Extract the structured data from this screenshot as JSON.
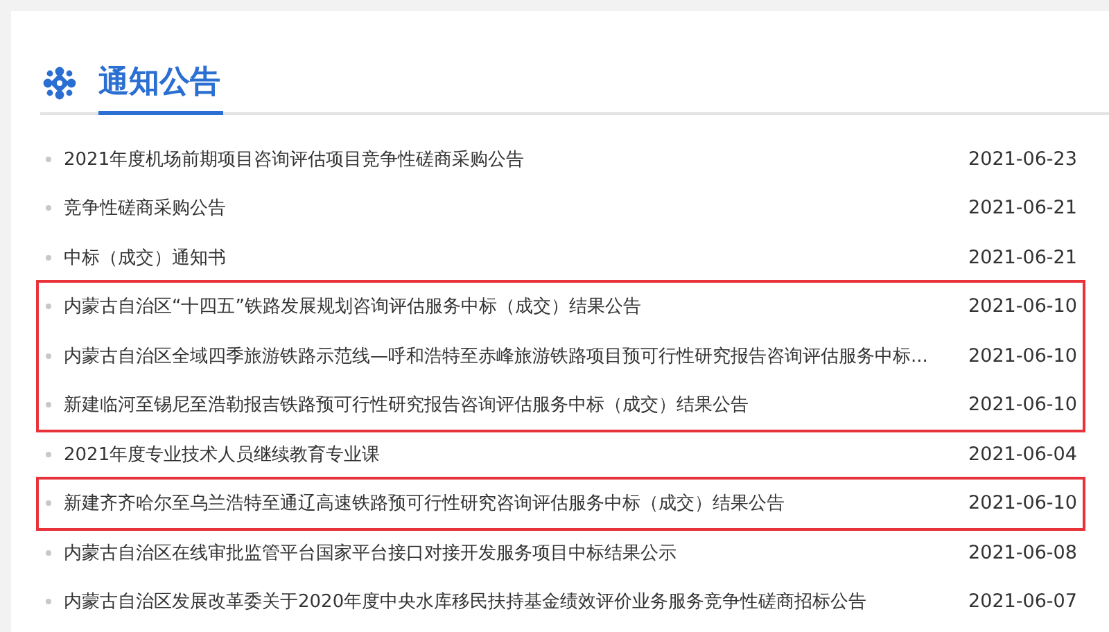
{
  "section": {
    "title": "通知公告"
  },
  "groups": [
    {
      "highlighted": false,
      "items": [
        {
          "title": "2021年度机场前期项目咨询评估项目竞争性磋商采购公告",
          "date": "2021-06-23"
        },
        {
          "title": "竞争性磋商采购公告",
          "date": "2021-06-21"
        },
        {
          "title": "中标（成交）通知书",
          "date": "2021-06-21"
        }
      ]
    },
    {
      "highlighted": true,
      "items": [
        {
          "title": "内蒙古自治区“十四五”铁路发展规划咨询评估服务中标（成交）结果公告",
          "date": "2021-06-10"
        },
        {
          "title": "内蒙古自治区全域四季旅游铁路示范线—呼和浩特至赤峰旅游铁路项目预可行性研究报告咨询评估服务中标...",
          "date": "2021-06-10"
        },
        {
          "title": "新建临河至锡尼至浩勒报吉铁路预可行性研究报告咨询评估服务中标（成交）结果公告",
          "date": "2021-06-10"
        }
      ]
    },
    {
      "highlighted": false,
      "items": [
        {
          "title": "2021年度专业技术人员继续教育专业课",
          "date": "2021-06-04"
        }
      ]
    },
    {
      "highlighted": true,
      "items": [
        {
          "title": "新建齐齐哈尔至乌兰浩特至通辽高速铁路预可行性研究咨询评估服务中标（成交）结果公告",
          "date": "2021-06-10"
        }
      ]
    },
    {
      "highlighted": false,
      "items": [
        {
          "title": "内蒙古自治区在线审批监管平台国家平台接口对接开发服务项目中标结果公示",
          "date": "2021-06-08"
        },
        {
          "title": "内蒙古自治区发展改革委关于2020年度中央水库移民扶持基金绩效评价业务服务竞争性磋商招标公告",
          "date": "2021-06-07"
        }
      ]
    }
  ]
}
